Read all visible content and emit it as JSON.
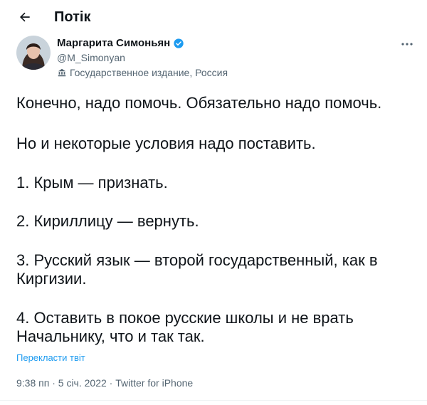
{
  "header": {
    "title": "Потік"
  },
  "author": {
    "display_name": "Маргарита Симоньян",
    "handle": "@M_Simonyan",
    "label": "Государственное издание, Россия",
    "verified": true,
    "verified_color": "#1d9bf0"
  },
  "tweet": {
    "paragraphs": [
      "Конечно, надо помочь. Обязательно надо помочь.",
      "Но и некоторые условия надо поставить.",
      "1. Крым — признать.",
      "2. Кириллицу — вернуть.",
      "3. Русский язык — второй государственный, как в Киргизии.",
      "4. Оставить в покое русские школы и не врать Начальнику, что и так так."
    ],
    "translate_label": "Перекласти твіт",
    "time": "9:38 пп",
    "date": "5 січ. 2022",
    "source": "Twitter for iPhone",
    "separator": "·"
  },
  "icons": {
    "back": "arrow-left-icon",
    "more": "more-horizontal-icon",
    "verified": "verified-badge-icon",
    "state_media": "state-media-icon"
  },
  "colors": {
    "text": "#0f1419",
    "secondary": "#536471",
    "accent": "#1d9bf0"
  }
}
